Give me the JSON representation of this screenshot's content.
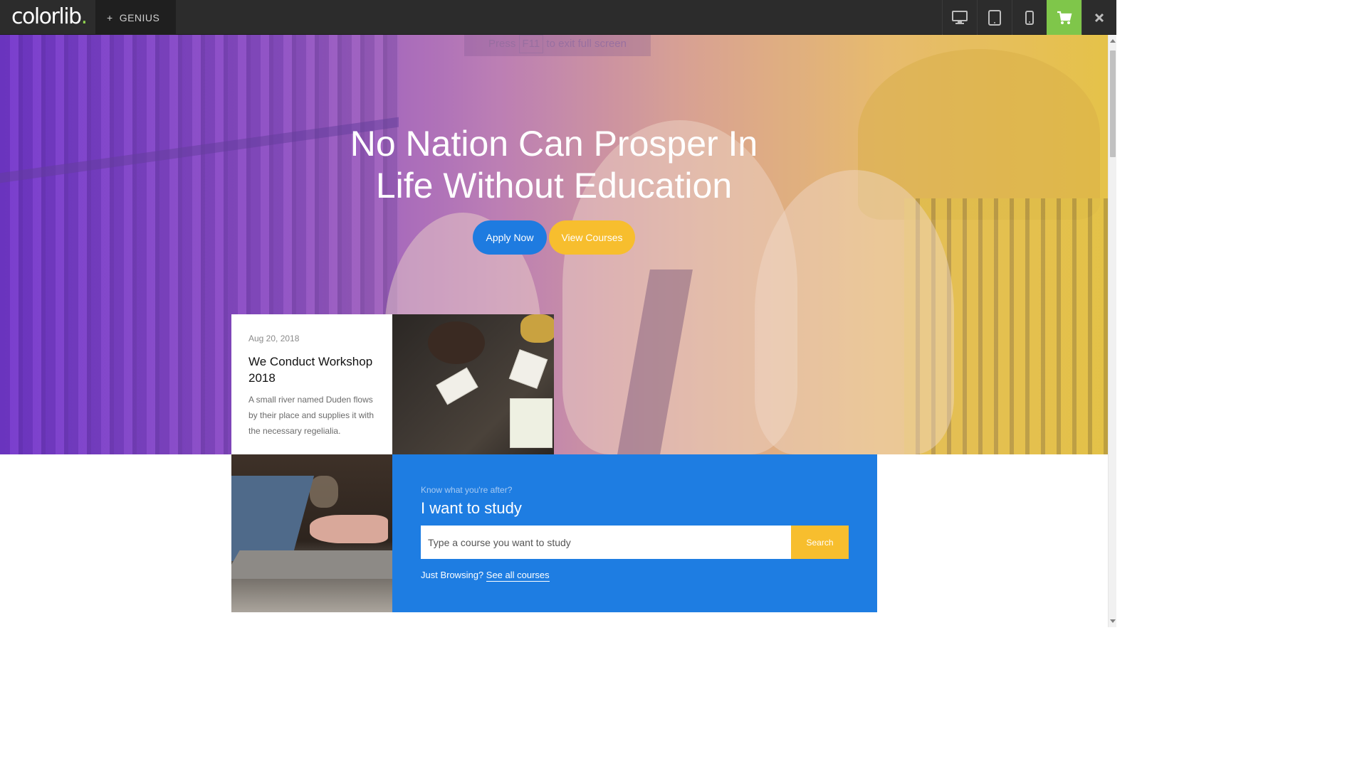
{
  "preview_bar": {
    "logo": "colorlib",
    "logo_dot": ".",
    "theme_name": "GENIUS",
    "theme_plus": "+",
    "accent_cart": "#7fc64a"
  },
  "fullscreen_hint": {
    "before": "Press",
    "key": "F11",
    "after": "to exit full screen"
  },
  "hero": {
    "title_line1": "No Nation Can Prosper In",
    "title_line2": "Life Without Education",
    "apply_label": "Apply Now",
    "courses_label": "View Courses",
    "apply_color": "#1e7be0",
    "courses_color": "#f7be2e"
  },
  "event": {
    "date": "Aug 20, 2018",
    "title": "We Conduct Workshop 2018",
    "text": "A small river named Duden flows by their place and supplies it with the necessary regelialia."
  },
  "study": {
    "kicker": "Know what you're after?",
    "title": "I want to study",
    "input_placeholder": "Type a course you want to study",
    "search_label": "Search",
    "browse_text": "Just Browsing?",
    "browse_link": "See all courses",
    "bg_color": "#1e7de2"
  }
}
